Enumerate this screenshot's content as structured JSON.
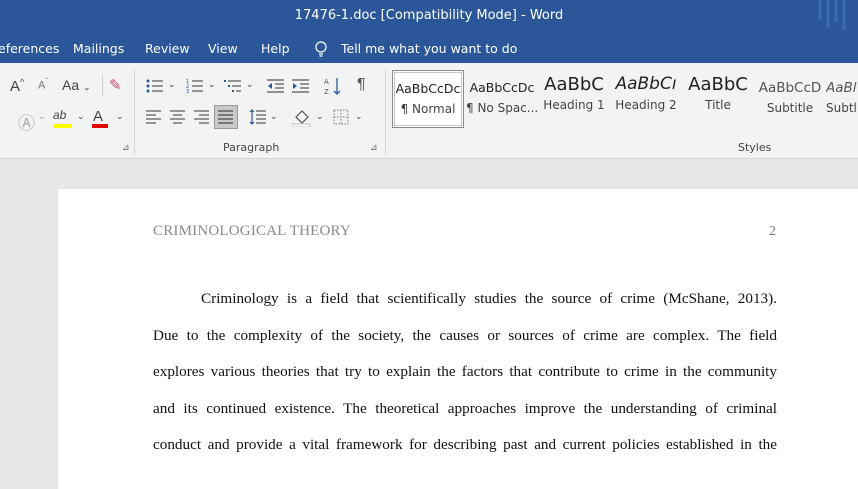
{
  "window": {
    "title": "17476-1.doc [Compatibility Mode]  -  Word"
  },
  "menu": {
    "items": [
      "eferences",
      "Mailings",
      "Review",
      "View",
      "Help"
    ],
    "tell_me": "Tell me what you want to do"
  },
  "ribbon": {
    "font_size_label": "Aa",
    "paragraph_group_label": "Paragraph",
    "styles_group_label": "Styles",
    "styles": [
      {
        "preview": "AaBbCcDc",
        "name": "¶ Normal"
      },
      {
        "preview": "AaBbCcDc",
        "name": "¶ No Spac..."
      },
      {
        "preview": "AaBbC",
        "name": "Heading 1"
      },
      {
        "preview": "AaBbCı",
        "name": "Heading 2"
      },
      {
        "preview": "AaBbC",
        "name": "Title"
      },
      {
        "preview": "AaBbCcD",
        "name": "Subtitle"
      },
      {
        "preview": "AaBl",
        "name": "Subtl"
      }
    ]
  },
  "document": {
    "header": "CRIMINOLOGICAL THEORY",
    "page_number": "2",
    "lines": [
      "Criminology is a field that scientifically studies the source of crime (McShane, 2013).",
      "Due to the complexity of the society, the causes or sources of crime are complex. The field",
      "explores various theories that try to explain the factors that contribute to crime in the community",
      "and its continued existence. The theoretical approaches improve the understanding of criminal",
      "conduct and provide a vital framework for describing past and current policies established in the"
    ]
  }
}
